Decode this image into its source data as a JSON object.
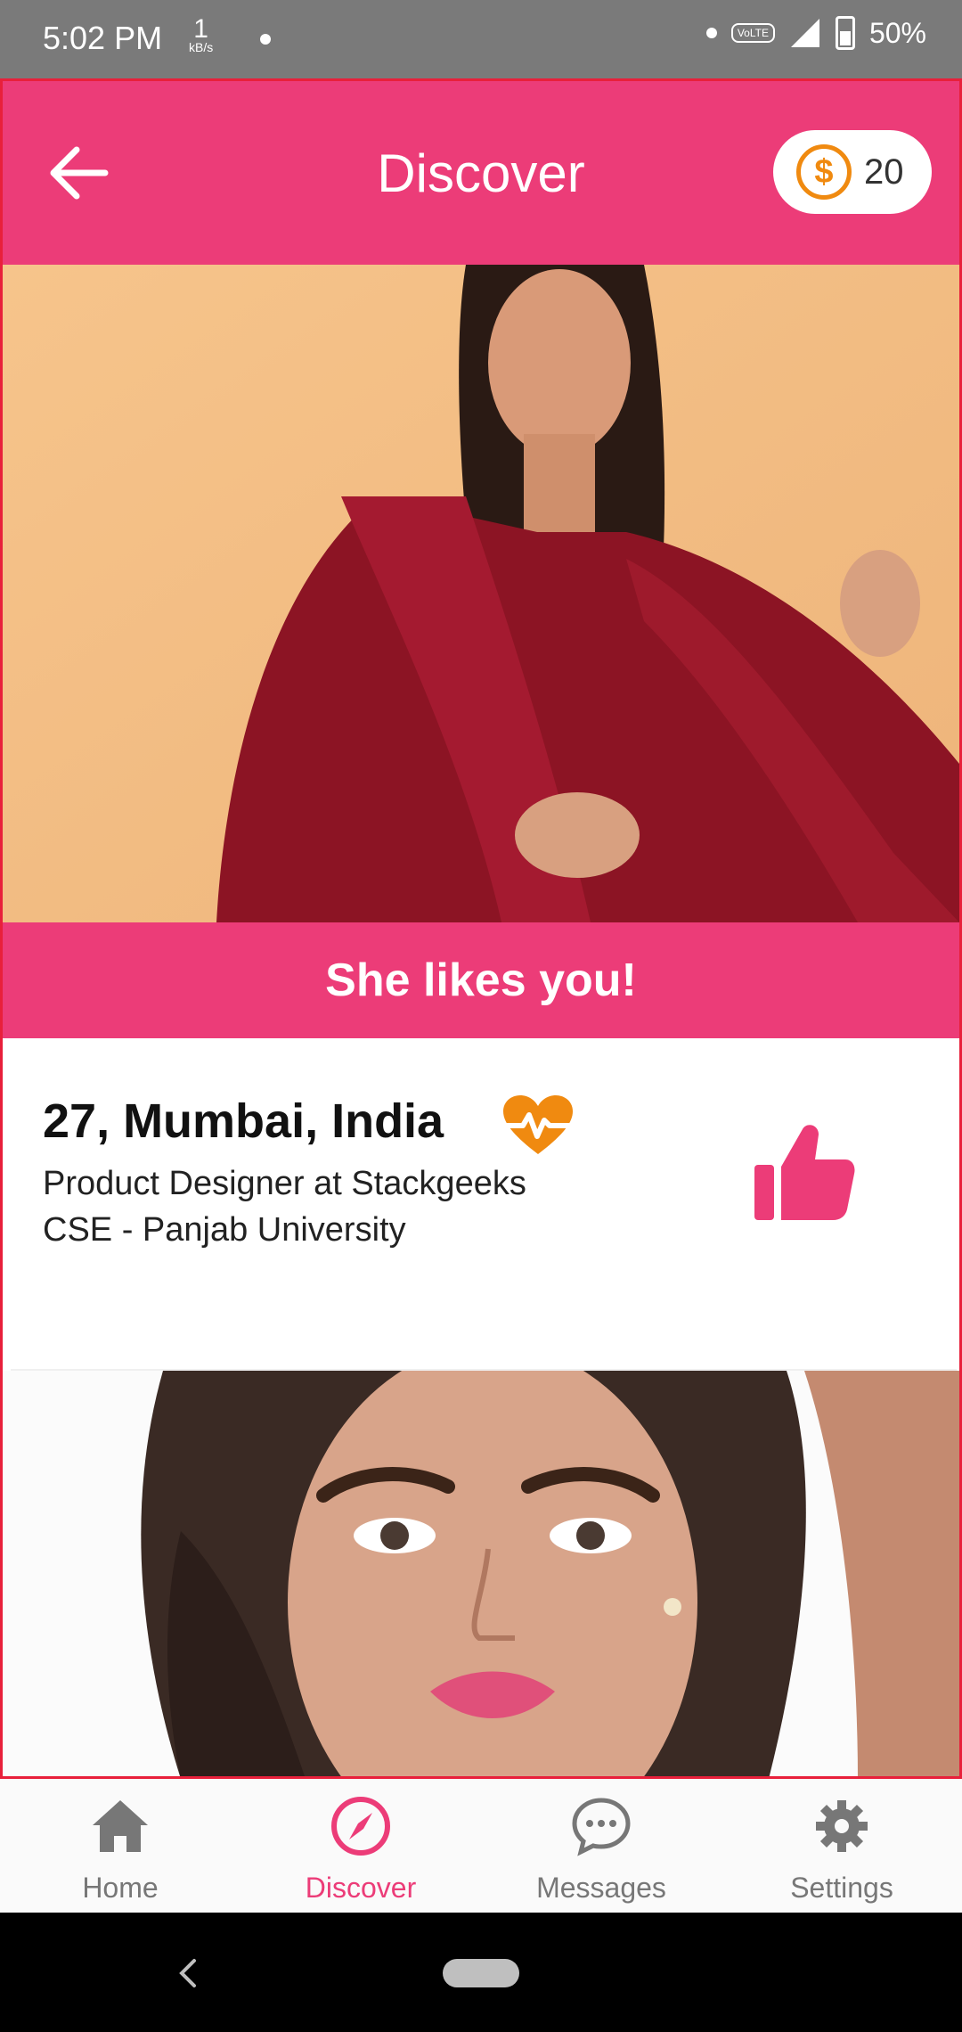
{
  "status_bar": {
    "time": "5:02 PM",
    "speed_value": "1",
    "speed_unit": "kB/s",
    "volte": "VoLTE",
    "battery": "50%"
  },
  "app_bar": {
    "back_icon": "arrow-left-icon",
    "title": "Discover",
    "coins": {
      "icon": "dollar-coin-icon",
      "symbol": "$",
      "count": "20"
    }
  },
  "cards": [
    {
      "banner": "She likes you!",
      "headline": "27, Mumbai, India",
      "badge_icon": "heartbeat-icon",
      "line1": "Product Designer at Stackgeeks",
      "line2": "CSE - Panjab University",
      "action_icon": "thumbs-up-icon"
    }
  ],
  "bottom_nav": [
    {
      "label": "Home",
      "icon": "home-icon",
      "active": false
    },
    {
      "label": "Discover",
      "icon": "compass-icon",
      "active": true
    },
    {
      "label": "Messages",
      "icon": "chat-bubble-icon",
      "active": false
    },
    {
      "label": "Settings",
      "icon": "gear-icon",
      "active": false
    }
  ],
  "colors": {
    "primary": "#ec3c78",
    "accent_orange": "#f08a10",
    "nav_inactive": "#777777"
  }
}
